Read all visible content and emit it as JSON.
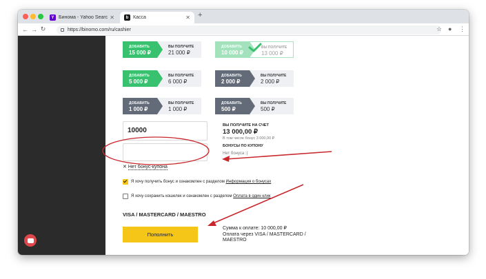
{
  "browser": {
    "tabs": [
      {
        "title": "Бинома - Yahoo Search Resul",
        "favicon": "Y",
        "color": "#6001d2"
      },
      {
        "title": "Касса",
        "favicon": "b",
        "color": "#1a1a1a"
      }
    ],
    "url": "https://binomo.com/ru/cashier"
  },
  "packages": [
    {
      "add_label": "ДОБАВИТЬ",
      "add_amount": "15 000 ₽",
      "get_label": "ВЫ ПОЛУЧИТЕ",
      "get_amount": "21 000 ₽",
      "style": "green"
    },
    {
      "add_label": "ДОБАВИТЬ",
      "add_amount": "10 000 ₽",
      "get_label": "ВЫ ПОЛУЧИТЕ",
      "get_amount": "13 000 ₽",
      "style": "green",
      "selected": true
    },
    {
      "add_label": "ДОБАВИТЬ",
      "add_amount": "5 000 ₽",
      "get_label": "ВЫ ПОЛУЧИТЕ",
      "get_amount": "6 000 ₽",
      "style": "green"
    },
    {
      "add_label": "ДОБАВИТЬ",
      "add_amount": "2 000 ₽",
      "get_label": "ВЫ ПОЛУЧИТЕ",
      "get_amount": "2 000 ₽",
      "style": "gray"
    },
    {
      "add_label": "ДОБАВИТЬ",
      "add_amount": "1 000 ₽",
      "get_label": "ВЫ ПОЛУЧИТЕ",
      "get_amount": "1 000 ₽",
      "style": "gray"
    },
    {
      "add_label": "ДОБАВИТЬ",
      "add_amount": "500 ₽",
      "get_label": "ВЫ ПОЛУЧИТЕ",
      "get_amount": "500 ₽",
      "style": "gray"
    }
  ],
  "amount_input": {
    "value": "10000"
  },
  "coupon": {
    "link": "Нет бонус-купона",
    "x": "✕"
  },
  "summary": {
    "label": "ВЫ ПОЛУЧИТЕ НА СЧЕТ",
    "total": "13 000,00 ₽",
    "bonus_note": "В том числе бонус 3 000,00 ₽",
    "coupon_bonus_label": "БОНУСЫ ПО КУПОНУ",
    "coupon_bonus_value": "Нет бонуса :("
  },
  "checkboxes": [
    {
      "text": "Я хочу получить бонус и ознакомлен с разделом ",
      "link": "Информация о бонусах",
      "checked": true
    },
    {
      "text": "Я хочу сохранить кошелек и ознакомлен с разделом ",
      "link": "Оплата в один клик",
      "checked": false
    }
  ],
  "payment": {
    "method": "VISA / MASTERCARD / MAESTRO",
    "button": "Пополнить",
    "sum_line": "Сумма к оплате: 10 000,00 ₽",
    "via_line": "Оплата через VISA / MASTERCARD / MAESTRO"
  },
  "colors": {
    "green": "#38c16f",
    "gray": "#646b78",
    "yellow": "#f5c518",
    "annotation_red": "#c8262b"
  }
}
